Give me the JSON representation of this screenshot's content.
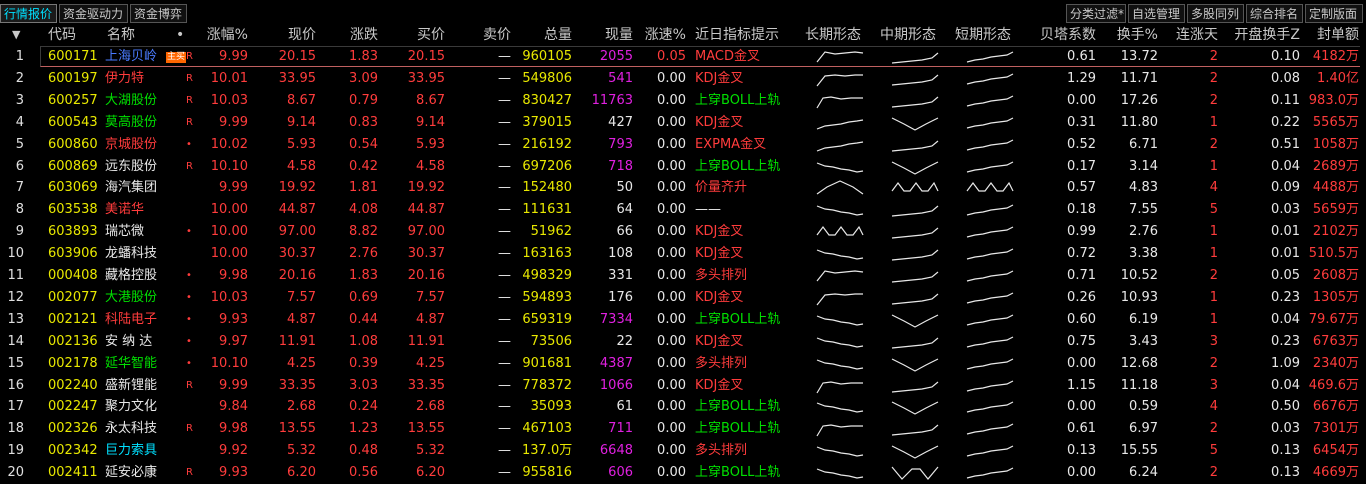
{
  "tabs_left": [
    "行情报价",
    "资金驱动力",
    "资金博弈"
  ],
  "tabs_right": [
    "分类过滤*",
    "自选管理",
    "多股同列",
    "综合排名",
    "定制版面"
  ],
  "headers": {
    "sort_arrow": "▼",
    "code": "代码",
    "name": "名称",
    "dot": "•",
    "pct": "涨幅%",
    "price": "现价",
    "chg": "涨跌",
    "bid": "买价",
    "ask": "卖价",
    "vol": "总量",
    "cur": "现量",
    "speed": "涨速%",
    "hint": "近日指标提示",
    "long": "长期形态",
    "mid": "中期形态",
    "short": "短期形态",
    "beta": "贝塔系数",
    "turn": "换手%",
    "days": "连涨天",
    "open_turn": "开盘换手Z",
    "seal": "封单额"
  },
  "rows": [
    {
      "idx": "1",
      "code": "600171",
      "name": "上海贝岭",
      "name_color": "blue",
      "tag": "主买",
      "flag": "R",
      "pct": "9.99",
      "price": "20.15",
      "chg": "1.83",
      "bid": "20.15",
      "ask": "—",
      "vol": "960105",
      "cur": "2055",
      "cur_color": "magenta",
      "speed": "0.05",
      "speed_color": "red",
      "hint": "MACD金叉",
      "hint_color": "red",
      "long": "m1",
      "mid": "u1",
      "short": "u2",
      "beta": "0.61",
      "turn": "13.72",
      "days": "2",
      "open_turn": "0.10",
      "seal": "4182万"
    },
    {
      "idx": "2",
      "code": "600197",
      "name": "伊力特",
      "name_color": "red",
      "flag": "R",
      "pct": "10.01",
      "price": "33.95",
      "chg": "3.09",
      "bid": "33.95",
      "ask": "—",
      "vol": "549806",
      "cur": "541",
      "cur_color": "magenta",
      "speed": "0.00",
      "speed_color": "white",
      "hint": "KDJ金叉",
      "hint_color": "red",
      "long": "m2",
      "mid": "u1",
      "short": "u2",
      "beta": "1.29",
      "turn": "11.71",
      "days": "2",
      "open_turn": "0.08",
      "seal": "1.40亿"
    },
    {
      "idx": "3",
      "code": "600257",
      "name": "大湖股份",
      "name_color": "green",
      "flag": "R",
      "pct": "10.03",
      "price": "8.67",
      "chg": "0.79",
      "bid": "8.67",
      "ask": "—",
      "vol": "830427",
      "cur": "11763",
      "cur_color": "magenta",
      "speed": "0.00",
      "speed_color": "white",
      "hint": "上穿BOLL上轨",
      "hint_color": "green",
      "long": "m3",
      "mid": "u1",
      "short": "u2",
      "beta": "0.00",
      "turn": "17.26",
      "days": "2",
      "open_turn": "0.11",
      "seal": "983.0万"
    },
    {
      "idx": "4",
      "code": "600543",
      "name": "莫高股份",
      "name_color": "green",
      "flag": "R",
      "pct": "9.99",
      "price": "9.14",
      "chg": "0.83",
      "bid": "9.14",
      "ask": "—",
      "vol": "379015",
      "cur": "427",
      "cur_color": "white",
      "speed": "0.00",
      "speed_color": "white",
      "hint": "KDJ金叉",
      "hint_color": "red",
      "long": "u3",
      "mid": "v",
      "short": "u2",
      "beta": "0.31",
      "turn": "11.80",
      "days": "1",
      "open_turn": "0.22",
      "seal": "5565万"
    },
    {
      "idx": "5",
      "code": "600860",
      "name": "京城股份",
      "name_color": "red",
      "flag": "•",
      "pct": "10.02",
      "price": "5.93",
      "chg": "0.54",
      "bid": "5.93",
      "ask": "—",
      "vol": "216192",
      "cur": "793",
      "cur_color": "magenta",
      "speed": "0.00",
      "speed_color": "white",
      "hint": "EXPMA金叉",
      "hint_color": "red",
      "long": "u3",
      "mid": "u1",
      "short": "u2",
      "beta": "0.52",
      "turn": "6.71",
      "days": "2",
      "open_turn": "0.51",
      "seal": "1058万"
    },
    {
      "idx": "6",
      "code": "600869",
      "name": "远东股份",
      "name_color": "white",
      "flag": "R",
      "pct": "10.10",
      "price": "4.58",
      "chg": "0.42",
      "bid": "4.58",
      "ask": "—",
      "vol": "697206",
      "cur": "718",
      "cur_color": "magenta",
      "speed": "0.00",
      "speed_color": "white",
      "hint": "上穿BOLL上轨",
      "hint_color": "green",
      "long": "d1",
      "mid": "v",
      "short": "u2",
      "beta": "0.17",
      "turn": "3.14",
      "days": "1",
      "open_turn": "0.04",
      "seal": "2689万"
    },
    {
      "idx": "7",
      "code": "603069",
      "name": "海汽集团",
      "name_color": "white",
      "flag": "",
      "pct": "9.99",
      "price": "19.92",
      "chg": "1.81",
      "bid": "19.92",
      "ask": "—",
      "vol": "152480",
      "cur": "50",
      "cur_color": "white",
      "speed": "0.00",
      "speed_color": "white",
      "hint": "价量齐升",
      "hint_color": "red",
      "long": "hat",
      "mid": "na",
      "short": "na",
      "beta": "0.57",
      "turn": "4.83",
      "days": "4",
      "open_turn": "0.09",
      "seal": "4488万"
    },
    {
      "idx": "8",
      "code": "603538",
      "name": "美诺华",
      "name_color": "red",
      "flag": "",
      "pct": "10.00",
      "price": "44.87",
      "chg": "4.08",
      "bid": "44.87",
      "ask": "—",
      "vol": "111631",
      "cur": "64",
      "cur_color": "white",
      "speed": "0.00",
      "speed_color": "white",
      "hint": "——",
      "hint_color": "white",
      "long": "d1",
      "mid": "u1",
      "short": "u2",
      "beta": "0.18",
      "turn": "7.55",
      "days": "5",
      "open_turn": "0.03",
      "seal": "5659万"
    },
    {
      "idx": "9",
      "code": "603893",
      "name": "瑞芯微",
      "name_color": "white",
      "flag": "•",
      "pct": "10.00",
      "price": "97.00",
      "chg": "8.82",
      "bid": "97.00",
      "ask": "—",
      "vol": "51962",
      "cur": "66",
      "cur_color": "white",
      "speed": "0.00",
      "speed_color": "white",
      "hint": "KDJ金叉",
      "hint_color": "red",
      "long": "na",
      "mid": "u1",
      "short": "u2",
      "beta": "0.99",
      "turn": "2.76",
      "days": "1",
      "open_turn": "0.01",
      "seal": "2102万"
    },
    {
      "idx": "10",
      "code": "603906",
      "name": "龙蟠科技",
      "name_color": "white",
      "flag": "",
      "pct": "10.00",
      "price": "30.37",
      "chg": "2.76",
      "bid": "30.37",
      "ask": "—",
      "vol": "163163",
      "cur": "108",
      "cur_color": "white",
      "speed": "0.00",
      "speed_color": "white",
      "hint": "KDJ金叉",
      "hint_color": "red",
      "long": "d1",
      "mid": "u1",
      "short": "u2",
      "beta": "0.72",
      "turn": "3.38",
      "days": "1",
      "open_turn": "0.01",
      "seal": "510.5万"
    },
    {
      "idx": "11",
      "code": "000408",
      "name": "藏格控股",
      "name_color": "white",
      "flag": "•",
      "pct": "9.98",
      "price": "20.16",
      "chg": "1.83",
      "bid": "20.16",
      "ask": "—",
      "vol": "498329",
      "cur": "331",
      "cur_color": "white",
      "speed": "0.00",
      "speed_color": "white",
      "hint": "多头排列",
      "hint_color": "red",
      "long": "m1",
      "mid": "u1",
      "short": "u2",
      "beta": "0.71",
      "turn": "10.52",
      "days": "2",
      "open_turn": "0.05",
      "seal": "2608万"
    },
    {
      "idx": "12",
      "code": "002077",
      "name": "大港股份",
      "name_color": "green",
      "flag": "•",
      "pct": "10.03",
      "price": "7.57",
      "chg": "0.69",
      "bid": "7.57",
      "ask": "—",
      "vol": "594893",
      "cur": "176",
      "cur_color": "white",
      "speed": "0.00",
      "speed_color": "white",
      "hint": "KDJ金叉",
      "hint_color": "red",
      "long": "m2",
      "mid": "u1",
      "short": "u2",
      "beta": "0.26",
      "turn": "10.93",
      "days": "1",
      "open_turn": "0.23",
      "seal": "1305万"
    },
    {
      "idx": "13",
      "code": "002121",
      "name": "科陆电子",
      "name_color": "red",
      "flag": "•",
      "pct": "9.93",
      "price": "4.87",
      "chg": "0.44",
      "bid": "4.87",
      "ask": "—",
      "vol": "659319",
      "cur": "7334",
      "cur_color": "magenta",
      "speed": "0.00",
      "speed_color": "white",
      "hint": "上穿BOLL上轨",
      "hint_color": "green",
      "long": "d1",
      "mid": "v",
      "short": "u2",
      "beta": "0.60",
      "turn": "6.19",
      "days": "1",
      "open_turn": "0.04",
      "seal": "79.67万"
    },
    {
      "idx": "14",
      "code": "002136",
      "name": "安 纳 达",
      "name_color": "white",
      "flag": "•",
      "pct": "9.97",
      "price": "11.91",
      "chg": "1.08",
      "bid": "11.91",
      "ask": "—",
      "vol": "73506",
      "cur": "22",
      "cur_color": "white",
      "speed": "0.00",
      "speed_color": "white",
      "hint": "KDJ金叉",
      "hint_color": "red",
      "long": "d1",
      "mid": "u1",
      "short": "u2",
      "beta": "0.75",
      "turn": "3.43",
      "days": "3",
      "open_turn": "0.23",
      "seal": "6763万"
    },
    {
      "idx": "15",
      "code": "002178",
      "name": "延华智能",
      "name_color": "green",
      "flag": "•",
      "pct": "10.10",
      "price": "4.25",
      "chg": "0.39",
      "bid": "4.25",
      "ask": "—",
      "vol": "901681",
      "cur": "4387",
      "cur_color": "magenta",
      "speed": "0.00",
      "speed_color": "white",
      "hint": "多头排列",
      "hint_color": "red",
      "long": "d1",
      "mid": "v",
      "short": "u2",
      "beta": "0.00",
      "turn": "12.68",
      "days": "2",
      "open_turn": "1.09",
      "seal": "2340万"
    },
    {
      "idx": "16",
      "code": "002240",
      "name": "盛新锂能",
      "name_color": "white",
      "flag": "R",
      "pct": "9.99",
      "price": "33.35",
      "chg": "3.03",
      "bid": "33.35",
      "ask": "—",
      "vol": "778372",
      "cur": "1066",
      "cur_color": "magenta",
      "speed": "0.00",
      "speed_color": "white",
      "hint": "KDJ金叉",
      "hint_color": "red",
      "long": "m3",
      "mid": "u1",
      "short": "u2",
      "beta": "1.15",
      "turn": "11.18",
      "days": "3",
      "open_turn": "0.04",
      "seal": "469.6万"
    },
    {
      "idx": "17",
      "code": "002247",
      "name": "聚力文化",
      "name_color": "white",
      "flag": "",
      "pct": "9.84",
      "price": "2.68",
      "chg": "0.24",
      "bid": "2.68",
      "ask": "—",
      "vol": "35093",
      "cur": "61",
      "cur_color": "white",
      "speed": "0.00",
      "speed_color": "white",
      "hint": "上穿BOLL上轨",
      "hint_color": "green",
      "long": "d1",
      "mid": "v",
      "short": "u2",
      "beta": "0.00",
      "turn": "0.59",
      "days": "4",
      "open_turn": "0.50",
      "seal": "6676万"
    },
    {
      "idx": "18",
      "code": "002326",
      "name": "永太科技",
      "name_color": "white",
      "flag": "R",
      "pct": "9.98",
      "price": "13.55",
      "chg": "1.23",
      "bid": "13.55",
      "ask": "—",
      "vol": "467103",
      "cur": "711",
      "cur_color": "magenta",
      "speed": "0.00",
      "speed_color": "white",
      "hint": "上穿BOLL上轨",
      "hint_color": "green",
      "long": "m3",
      "mid": "u1",
      "short": "u2",
      "beta": "0.61",
      "turn": "6.97",
      "days": "2",
      "open_turn": "0.03",
      "seal": "7301万"
    },
    {
      "idx": "19",
      "code": "002342",
      "name": "巨力索具",
      "name_color": "cyan",
      "flag": "",
      "pct": "9.92",
      "price": "5.32",
      "chg": "0.48",
      "bid": "5.32",
      "ask": "—",
      "vol": "137.0万",
      "cur": "6648",
      "cur_color": "magenta",
      "speed": "0.00",
      "speed_color": "white",
      "hint": "多头排列",
      "hint_color": "red",
      "long": "d1",
      "mid": "v",
      "short": "u2",
      "beta": "0.13",
      "turn": "15.55",
      "days": "5",
      "open_turn": "0.13",
      "seal": "6454万"
    },
    {
      "idx": "20",
      "code": "002411",
      "name": "延安必康",
      "name_color": "white",
      "flag": "R",
      "pct": "9.93",
      "price": "6.20",
      "chg": "0.56",
      "bid": "6.20",
      "ask": "—",
      "vol": "955816",
      "cur": "606",
      "cur_color": "magenta",
      "speed": "0.00",
      "speed_color": "white",
      "hint": "上穿BOLL上轨",
      "hint_color": "green",
      "long": "d1",
      "mid": "w",
      "short": "u2",
      "beta": "0.00",
      "turn": "6.24",
      "days": "2",
      "open_turn": "0.13",
      "seal": "4669万"
    }
  ]
}
